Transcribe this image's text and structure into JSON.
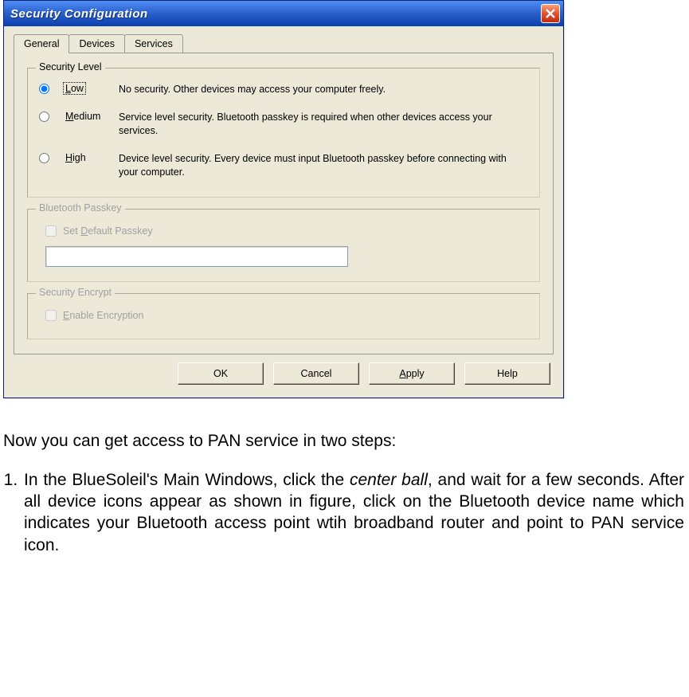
{
  "dialog": {
    "title": "Security Configuration",
    "tabs": {
      "general": "General",
      "devices": "Devices",
      "services": "Services"
    },
    "groups": {
      "security_level": {
        "title": "Security Level",
        "low": {
          "label": "Low",
          "desc": "No security. Other devices may access your computer freely."
        },
        "medium": {
          "label": "Medium",
          "desc": "Service level security. Bluetooth passkey is required when other devices access your services."
        },
        "high": {
          "label": "High",
          "desc": "Device level security. Every device must input Bluetooth passkey before connecting with your computer."
        }
      },
      "bluetooth_passkey": {
        "title": "Bluetooth Passkey",
        "checkbox": "Set Default Passkey"
      },
      "security_encrypt": {
        "title": "Security Encrypt",
        "checkbox": "Enable Encryption"
      }
    },
    "buttons": {
      "ok": "OK",
      "cancel": "Cancel",
      "apply": "Apply",
      "help": "Help"
    }
  },
  "doc": {
    "intro": "Now you can get access to PAN service in two steps:",
    "step1_prefix": "In the BlueSoleil's Main Windows, click the ",
    "step1_emph": "center ball",
    "step1_suffix": ", and wait for a few seconds. After all device icons appear as shown in figure, click on the Bluetooth device name which indicates your Bluetooth access point wtih broadband router and point to PAN service icon."
  }
}
